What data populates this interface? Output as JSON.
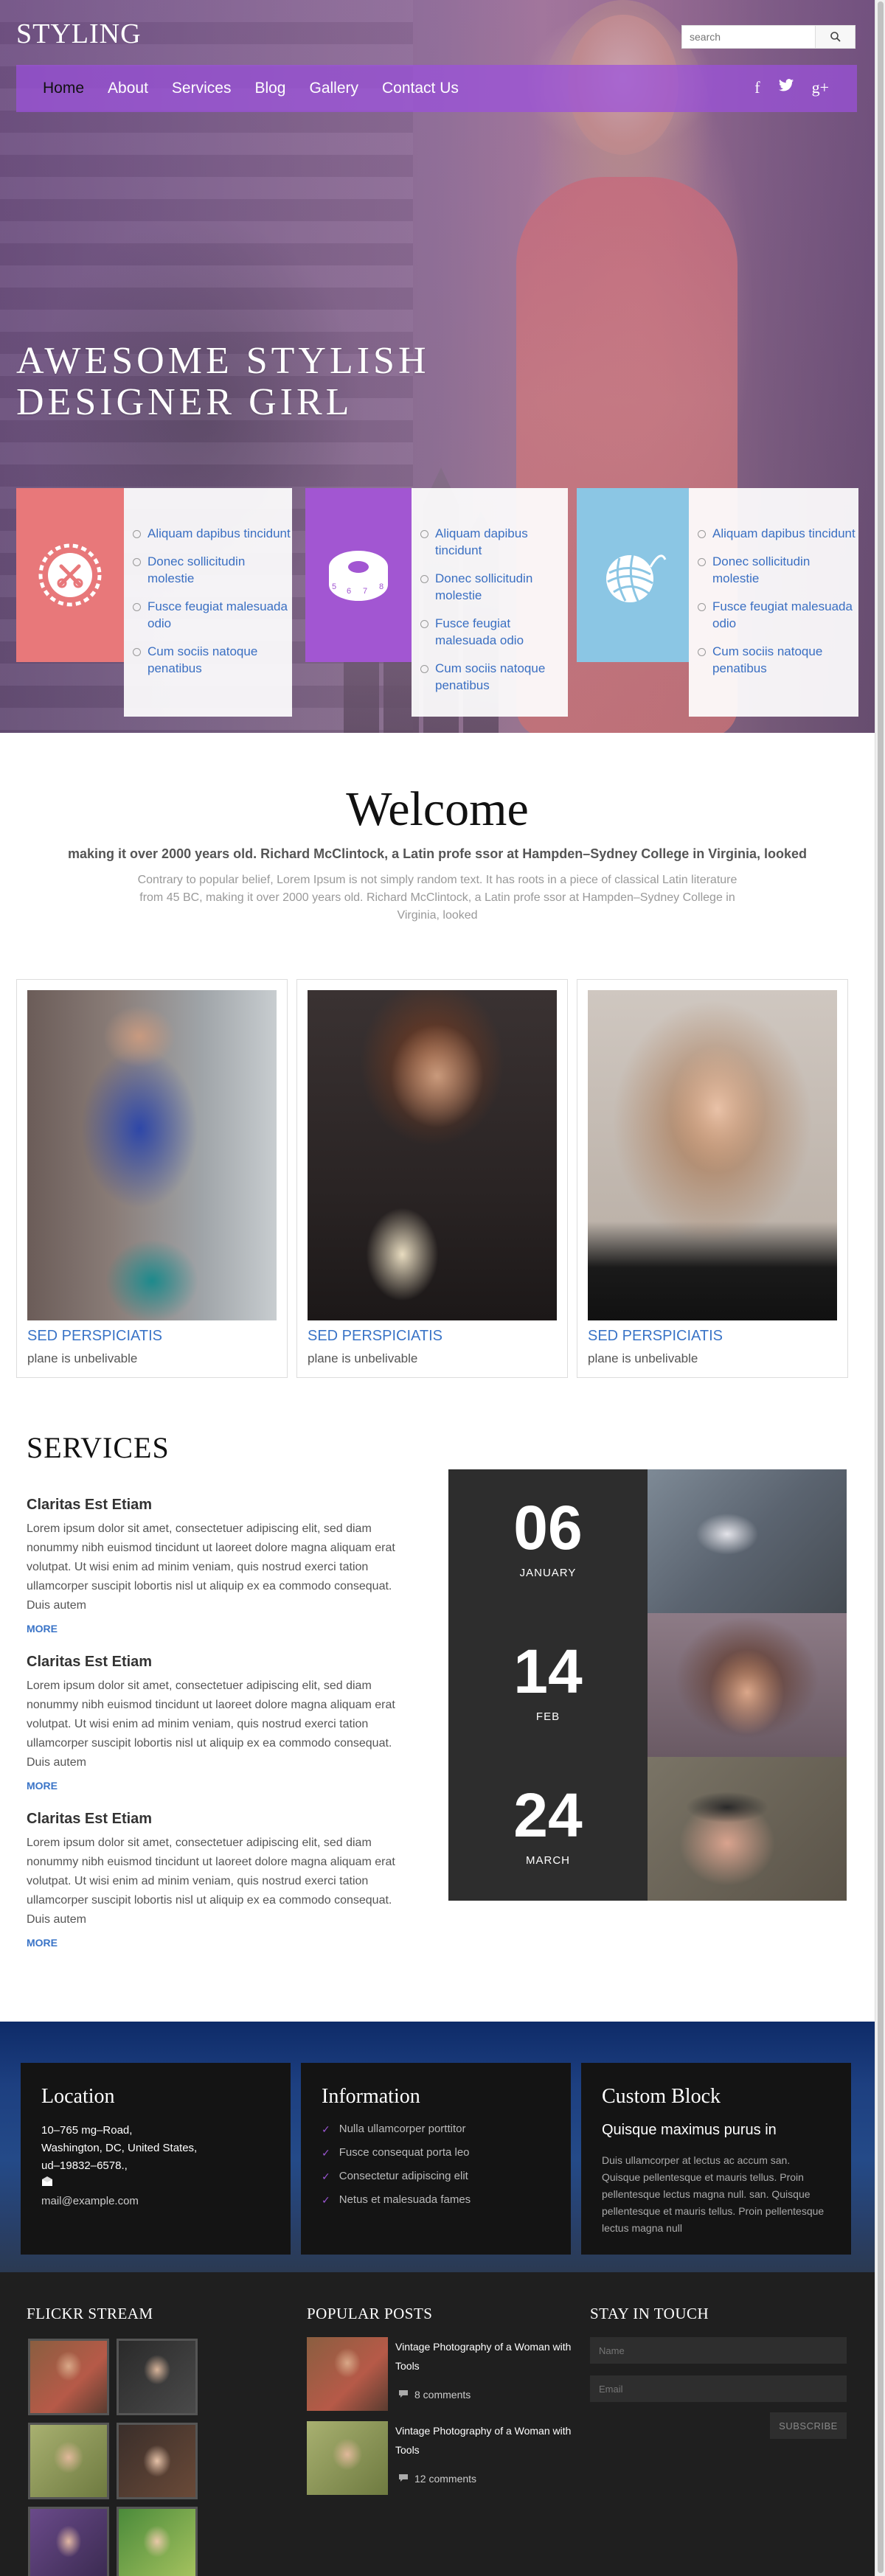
{
  "brand": {
    "logo": "STYLING"
  },
  "search": {
    "placeholder": "search"
  },
  "nav": {
    "items": [
      "Home",
      "About",
      "Services",
      "Blog",
      "Gallery",
      "Contact Us"
    ]
  },
  "social": {
    "facebook": "f",
    "twitter": "t",
    "googleplus": "g+"
  },
  "hero": {
    "title_line1": "AWESOME STYLISH",
    "title_line2": "DESIGNER GIRL"
  },
  "cards": [
    {
      "icon": "scissors-icon",
      "color": "#e8787a",
      "items": [
        "Aliquam dapibus tincidunt",
        "Donec sollicitudin molestie",
        "Fusce feugiat malesuada odio",
        "Cum sociis natoque penatibus"
      ]
    },
    {
      "icon": "measuring-tape-icon",
      "color": "#a256d2",
      "tape_numbers": [
        "5",
        "6",
        "7",
        "8"
      ],
      "items": [
        "Aliquam dapibus tincidunt",
        "Donec sollicitudin molestie",
        "Fusce feugiat malesuada odio",
        "Cum sociis natoque penatibus"
      ]
    },
    {
      "icon": "yarn-ball-icon",
      "color": "#8bc6e4",
      "items": [
        "Aliquam dapibus tincidunt",
        "Donec sollicitudin molestie",
        "Fusce feugiat malesuada odio",
        "Cum sociis natoque penatibus"
      ]
    }
  ],
  "welcome": {
    "title": "Welcome",
    "subtitle": "making it over 2000 years old. Richard McClintock, a Latin profe ssor at Hampden–Sydney College in Virginia, looked",
    "text": "Contrary to popular belief, Lorem Ipsum is not simply random text. It has roots in a piece of classical Latin literature from 45 BC, making it over 2000 years old. Richard McClintock, a Latin profe ssor at Hampden–Sydney College in Virginia, looked"
  },
  "gallery": [
    {
      "title": "SED PERSPICIATIS",
      "sub": "plane is unbelivable"
    },
    {
      "title": "SED PERSPICIATIS",
      "sub": "plane is unbelivable"
    },
    {
      "title": "SED PERSPICIATIS",
      "sub": "plane is unbelivable"
    }
  ],
  "services": {
    "title": "SERVICES",
    "items": [
      {
        "heading": "Claritas Est Etiam",
        "text": "Lorem ipsum dolor sit amet, consectetuer adipiscing elit, sed diam nonummy nibh euismod tincidunt ut laoreet dolore magna aliquam erat volutpat. Ut wisi enim ad minim veniam, quis nostrud exerci tation ullamcorper suscipit lobortis nisl ut aliquip ex ea commodo consequat. Duis autem",
        "more": "MORE"
      },
      {
        "heading": "Claritas Est Etiam",
        "text": "Lorem ipsum dolor sit amet, consectetuer adipiscing elit, sed diam nonummy nibh euismod tincidunt ut laoreet dolore magna aliquam erat volutpat. Ut wisi enim ad minim veniam, quis nostrud exerci tation ullamcorper suscipit lobortis nisl ut aliquip ex ea commodo consequat. Duis autem",
        "more": "MORE"
      },
      {
        "heading": "Claritas Est Etiam",
        "text": "Lorem ipsum dolor sit amet, consectetuer adipiscing elit, sed diam nonummy nibh euismod tincidunt ut laoreet dolore magna aliquam erat volutpat. Ut wisi enim ad minim veniam, quis nostrud exerci tation ullamcorper suscipit lobortis nisl ut aliquip ex ea commodo consequat. Duis autem",
        "more": "MORE"
      }
    ]
  },
  "dates": [
    {
      "day": "06",
      "month": "JANUARY"
    },
    {
      "day": "14",
      "month": "FEB"
    },
    {
      "day": "24",
      "month": "MARCH"
    }
  ],
  "location": {
    "title": "Location",
    "lines": [
      "10–765 mg–Road,",
      "Washington, DC, United States,",
      "ud–19832–6578.,"
    ],
    "email": "mail@example.com"
  },
  "information": {
    "title": "Information",
    "items": [
      "Nulla ullamcorper porttitor",
      "Fusce consequat porta leo",
      "Consectetur adipiscing elit",
      "Netus et malesuada fames"
    ]
  },
  "custom_block": {
    "title": "Custom Block",
    "heading": "Quisque maximus purus in",
    "text": "Duis ullamcorper at lectus ac accum san. Quisque pellentesque et mauris tellus. Proin pellentesque lectus magna null. san. Quisque pellentesque et mauris tellus. Proin pellentesque lectus magna null"
  },
  "footer": {
    "flickr_title": "FLICKR STREAM",
    "popular_title": "POPULAR POSTS",
    "stay_title": "STAY IN TOUCH",
    "posts": [
      {
        "title": "Vintage Photography of a Woman with Tools",
        "comments": "8 comments"
      },
      {
        "title": "Vintage Photography of a Woman with Tools",
        "comments": "12 comments"
      }
    ],
    "name_placeholder": "Name",
    "email_placeholder": "Email",
    "subscribe": "SUBSCRIBE"
  }
}
